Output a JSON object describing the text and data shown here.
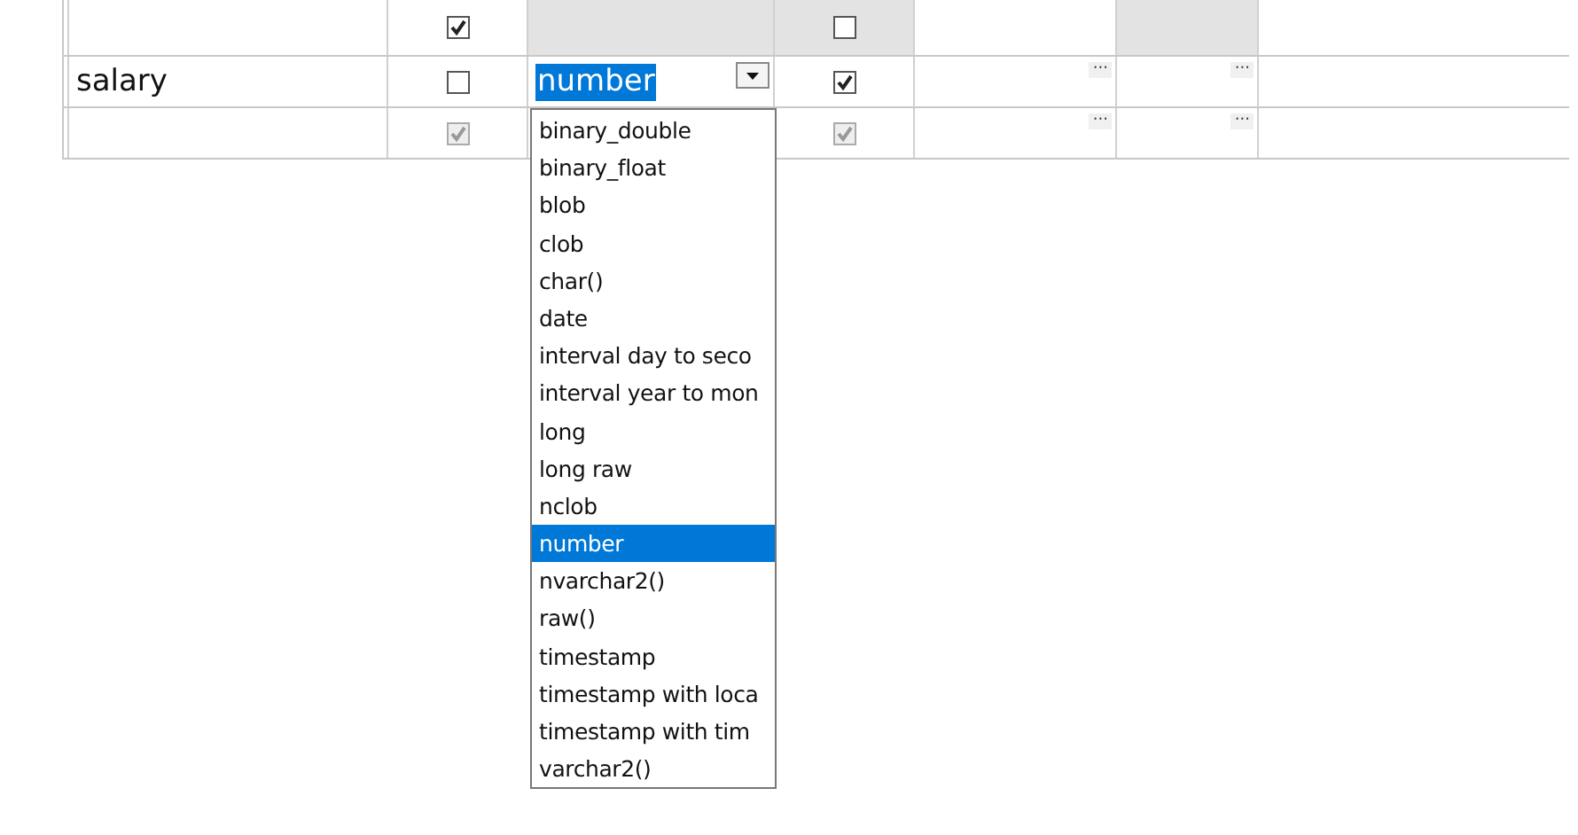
{
  "grid": {
    "rows": [
      {
        "name": "",
        "col_2": {
          "checked": true,
          "disabled": false
        },
        "type": "",
        "col_4": {
          "checked": false,
          "disabled": false
        },
        "shaded": true,
        "col_5": "",
        "col_6": ""
      },
      {
        "name": "salary",
        "col_2": {
          "checked": false,
          "disabled": false
        },
        "type": "number",
        "editing": true,
        "col_4": {
          "checked": true,
          "disabled": false
        },
        "shaded": false,
        "col_5": "···",
        "col_6": "···"
      },
      {
        "name": "",
        "col_2": {
          "checked": true,
          "disabled": true
        },
        "type": "",
        "col_4": {
          "checked": true,
          "disabled": true
        },
        "shaded": false,
        "col_5": "···",
        "col_6": "···"
      }
    ]
  },
  "type_dropdown": {
    "items": [
      {
        "label": "binary_double",
        "selected": false
      },
      {
        "label": "binary_float",
        "selected": false
      },
      {
        "label": "blob",
        "selected": false
      },
      {
        "label": "clob",
        "selected": false
      },
      {
        "label": "char()",
        "selected": false
      },
      {
        "label": "date",
        "selected": false
      },
      {
        "label": "interval day to seco",
        "selected": false
      },
      {
        "label": "interval year to mon",
        "selected": false
      },
      {
        "label": "long",
        "selected": false
      },
      {
        "label": "long raw",
        "selected": false
      },
      {
        "label": "nclob",
        "selected": false
      },
      {
        "label": "number",
        "selected": true
      },
      {
        "label": "nvarchar2()",
        "selected": false
      },
      {
        "label": "raw()",
        "selected": false
      },
      {
        "label": "timestamp",
        "selected": false
      },
      {
        "label": "timestamp with loca",
        "selected": false
      },
      {
        "label": "timestamp with tim",
        "selected": false
      },
      {
        "label": "varchar2()",
        "selected": false
      }
    ]
  }
}
